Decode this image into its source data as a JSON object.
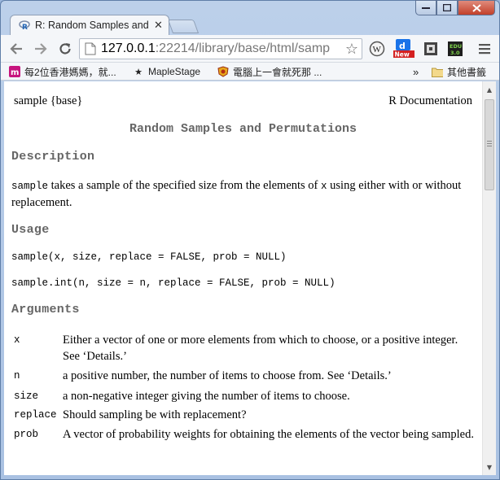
{
  "browser": {
    "tab_title": "R: Random Samples and",
    "url_host": "127.0.0.1",
    "url_rest": ":22214/library/base/html/samp",
    "bookmarks": [
      {
        "label": "每2位香港媽媽，就...",
        "icon": "m-logo-icon"
      },
      {
        "label": "MapleStage",
        "icon": "star-icon"
      },
      {
        "label": "電腦上一會就死那 ...",
        "icon": "crest-icon"
      }
    ],
    "bookmarks_overflow": "»",
    "other_bookmarks": "其他書籤"
  },
  "doc": {
    "topic": "sample {base}",
    "doc_label": "R Documentation",
    "title": "Random Samples and Permutations",
    "sections": {
      "description": "Description",
      "usage": "Usage",
      "arguments": "Arguments"
    },
    "description": {
      "code1": "sample",
      "text1": " takes a sample of the specified size from the elements of ",
      "code2": "x",
      "text2": " using either with or without replacement."
    },
    "usage_lines": [
      "sample(x, size, replace = FALSE, prob = NULL)",
      "sample.int(n, size = n, replace = FALSE, prob = NULL)"
    ],
    "arguments": [
      {
        "name": "x",
        "desc": "Either a vector of one or more elements from which to choose, or a positive integer. See ‘Details.’"
      },
      {
        "name": "n",
        "desc": "a positive number, the number of items to choose from. See ‘Details.’"
      },
      {
        "name": "size",
        "desc": "a non-negative integer giving the number of items to choose."
      },
      {
        "name": "replace",
        "desc": "Should sampling be with replacement?"
      },
      {
        "name": "prob",
        "desc": "A vector of probability weights for obtaining the elements of the vector being sampled."
      }
    ]
  },
  "colors": {
    "section_heading": "#666666",
    "close_button": "#c2402a"
  }
}
